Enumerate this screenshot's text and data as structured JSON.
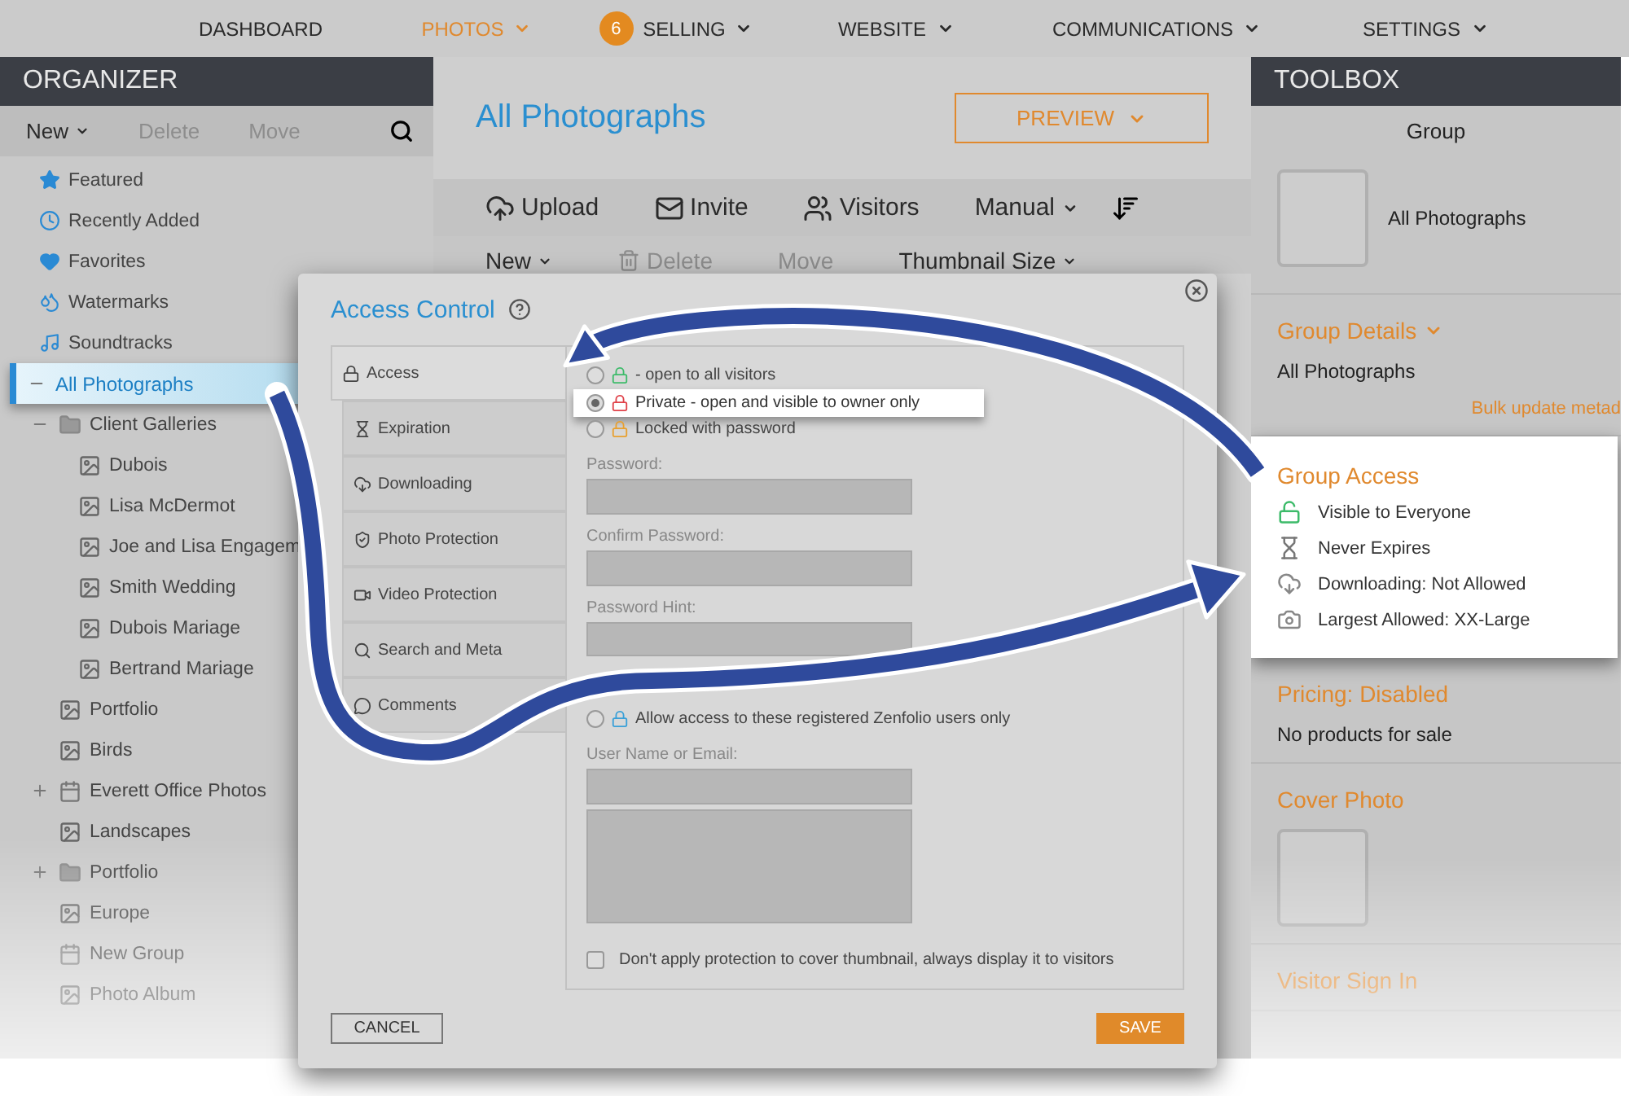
{
  "nav": [
    {
      "label": "DASHBOARD",
      "selected": false,
      "dropdown": false
    },
    {
      "label": "PHOTOS",
      "selected": true,
      "dropdown": true
    },
    {
      "label": "SELLING",
      "selected": false,
      "dropdown": true,
      "badge": "6"
    },
    {
      "label": "WEBSITE",
      "selected": false,
      "dropdown": true
    },
    {
      "label": "COMMUNICATIONS",
      "selected": false,
      "dropdown": true
    },
    {
      "label": "SETTINGS",
      "selected": false,
      "dropdown": true
    }
  ],
  "organizer": {
    "title": "ORGANIZER",
    "toolbar": [
      {
        "label": "New",
        "disabled": false,
        "dropdown": true
      },
      {
        "label": "Delete",
        "disabled": true,
        "dropdown": false
      },
      {
        "label": "Move",
        "disabled": true,
        "dropdown": false
      }
    ],
    "tree": [
      {
        "label": "Featured",
        "kind": "star",
        "selected": false
      },
      {
        "label": "Recently Added",
        "kind": "recent",
        "selected": false
      },
      {
        "label": "Favorites",
        "kind": "favorites",
        "selected": false
      },
      {
        "label": "Watermarks",
        "kind": "watermarks",
        "selected": false
      },
      {
        "label": "Soundtracks",
        "kind": "soundtracks",
        "selected": false
      },
      {
        "label": "All Photographs",
        "kind": "root",
        "selected": true,
        "expanded": true,
        "children": [
          {
            "label": "Client Galleries",
            "kind": "group",
            "selected": false,
            "expanded": true,
            "children": [
              {
                "label": "Dubois",
                "kind": "gallery",
                "selected": false
              },
              {
                "label": "Lisa McDermot",
                "kind": "gallery",
                "selected": false
              },
              {
                "label": "Joe and Lisa Engagem",
                "kind": "gallery",
                "selected": false
              },
              {
                "label": "Smith Wedding",
                "kind": "gallery",
                "selected": false
              },
              {
                "label": "Dubois Mariage",
                "kind": "gallery",
                "selected": false
              },
              {
                "label": "Bertrand Mariage",
                "kind": "gallery",
                "selected": false
              }
            ]
          },
          {
            "label": "Portfolio",
            "kind": "gallery",
            "selected": false
          },
          {
            "label": "Birds",
            "kind": "gallery",
            "selected": false
          },
          {
            "label": "Everett Office Photos",
            "kind": "collection",
            "selected": false,
            "expanded": false
          },
          {
            "label": "Landscapes",
            "kind": "gallery",
            "selected": false
          },
          {
            "label": "Portfolio",
            "kind": "group",
            "selected": false,
            "expanded": false
          },
          {
            "label": "Europe",
            "kind": "gallery",
            "selected": false
          },
          {
            "label": "New Group",
            "kind": "collection",
            "selected": false
          },
          {
            "label": "Photo Album",
            "kind": "gallery",
            "selected": false
          }
        ]
      }
    ]
  },
  "main": {
    "title": "All Photographs",
    "preview": "PREVIEW",
    "actions": [
      {
        "label": "Upload",
        "kind": "upload"
      },
      {
        "label": "Invite",
        "kind": "invite"
      },
      {
        "label": "Visitors",
        "kind": "visitors"
      },
      {
        "label": "Manual",
        "kind": "dropdown"
      }
    ],
    "toolbar": [
      {
        "label": "New",
        "kind": "dropdown",
        "disabled": false
      },
      {
        "label": "Delete",
        "kind": "delete",
        "disabled": true
      },
      {
        "label": "Move",
        "kind": "plain",
        "disabled": true
      },
      {
        "label": "Thumbnail Size",
        "kind": "dropdown",
        "disabled": false
      }
    ]
  },
  "toolbox": {
    "title": "TOOLBOX",
    "group_label": "Group",
    "group_name": "All Photographs",
    "details": {
      "title": "Group Details",
      "value": "All Photographs",
      "link": "Bulk update metad"
    },
    "access": {
      "title": "Group Access",
      "items": [
        {
          "kind": "unlocked",
          "text": "Visible to Everyone"
        },
        {
          "kind": "hourglass",
          "text": "Never Expires"
        },
        {
          "kind": "download",
          "text": "Downloading: Not Allowed"
        },
        {
          "kind": "camera",
          "text": "Largest Allowed: XX-Large"
        }
      ]
    },
    "pricing": {
      "title": "Pricing: Disabled",
      "text": "No products for sale"
    },
    "cover": {
      "title": "Cover Photo"
    },
    "visitor": {
      "title": "Visitor Sign In"
    }
  },
  "dialog": {
    "title": "Access Control",
    "tabs": [
      {
        "label": "Access",
        "kind": "lock",
        "selected": true
      },
      {
        "label": "Expiration",
        "kind": "hourglass",
        "selected": false
      },
      {
        "label": "Downloading",
        "kind": "download",
        "selected": false
      },
      {
        "label": "Photo Protection",
        "kind": "shield",
        "selected": false
      },
      {
        "label": "Video Protection",
        "kind": "video",
        "selected": false
      },
      {
        "label": "Search and Meta",
        "kind": "search",
        "selected": false
      },
      {
        "label": "Comments",
        "kind": "comment",
        "selected": false
      }
    ],
    "options": [
      {
        "label": "- open to all visitors",
        "selected": false,
        "highlighted": false,
        "color": "#3dbb6a"
      },
      {
        "label": "Private - open and visible to owner only",
        "selected": true,
        "highlighted": true,
        "color": "#e0424a"
      },
      {
        "label": "Locked with password",
        "selected": false,
        "highlighted": false,
        "color": "#e8a030"
      }
    ],
    "fields": [
      {
        "label": "Password:"
      },
      {
        "label": "Confirm Password:"
      },
      {
        "label": "Password Hint:"
      }
    ],
    "registered": {
      "label": "Allow access to these registered Zenfolio users only",
      "selected": false,
      "color": "#3aa0d8",
      "field_label": "User Name or Email:"
    },
    "cover_option": {
      "label": "Don't apply protection to cover thumbnail, always display it to visitors",
      "checked": false
    },
    "cancel": "CANCEL",
    "save": "SAVE"
  }
}
